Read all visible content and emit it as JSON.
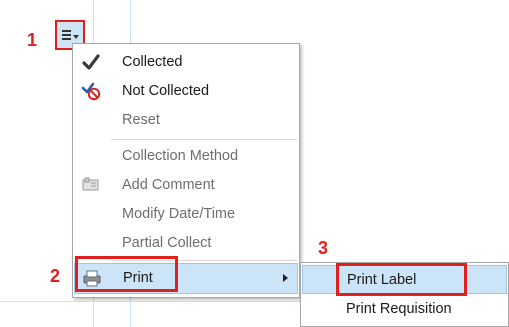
{
  "annotations": {
    "step1": "1",
    "step2": "2",
    "step3": "3",
    "color": "#e0201d"
  },
  "menu_button": {
    "icon": "hamburger-menu-icon"
  },
  "context_menu": {
    "items": [
      {
        "label": "Collected",
        "icon": "checkmark-icon",
        "enabled": true
      },
      {
        "label": "Not Collected",
        "icon": "not-collected-icon",
        "enabled": true
      },
      {
        "label": "Reset",
        "icon": "",
        "enabled": false
      },
      {
        "label": "Collection Method",
        "icon": "",
        "enabled": false
      },
      {
        "label": "Add Comment",
        "icon": "comment-icon",
        "enabled": false
      },
      {
        "label": "Modify Date/Time",
        "icon": "",
        "enabled": false
      },
      {
        "label": "Partial Collect",
        "icon": "",
        "enabled": false
      },
      {
        "label": "Print",
        "icon": "printer-icon",
        "enabled": true,
        "has_submenu": true
      }
    ]
  },
  "print_submenu": {
    "items": [
      {
        "label": "Print Label"
      },
      {
        "label": "Print Requisition"
      }
    ]
  },
  "colors": {
    "highlight": "#cce4f7",
    "highlight_border": "#9cc7ea",
    "disabled_text": "#6e6e6e",
    "annotation_red": "#e0201d"
  }
}
